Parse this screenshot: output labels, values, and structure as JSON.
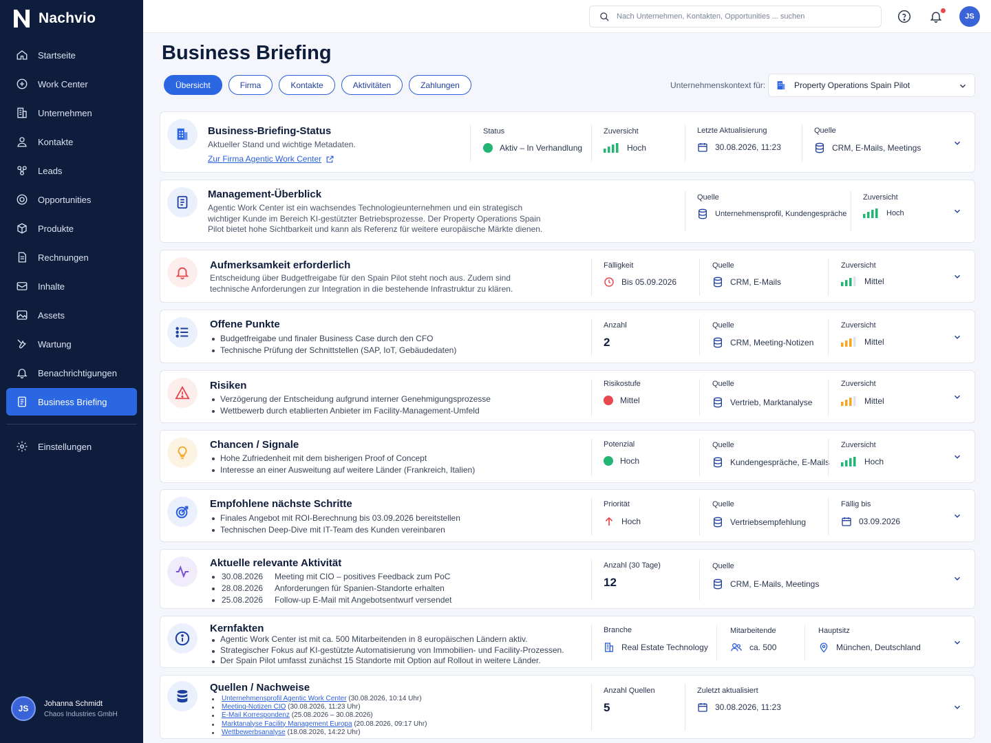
{
  "app": {
    "name": "Nachvio"
  },
  "sidebar": {
    "items": [
      {
        "label": "Startseite",
        "icon": "home-icon"
      },
      {
        "label": "Work Center",
        "icon": "work-center-icon"
      },
      {
        "label": "Unternehmen",
        "icon": "building-icon"
      },
      {
        "label": "Kontakte",
        "icon": "contacts-icon"
      },
      {
        "label": "Leads",
        "icon": "leads-icon"
      },
      {
        "label": "Opportunities",
        "icon": "target-icon"
      },
      {
        "label": "Produkte",
        "icon": "box-icon"
      },
      {
        "label": "Rechnungen",
        "icon": "invoice-icon"
      },
      {
        "label": "Inhalte",
        "icon": "content-icon"
      },
      {
        "label": "Assets",
        "icon": "image-icon"
      },
      {
        "label": "Wartung",
        "icon": "wrench-icon"
      },
      {
        "label": "Benachrichtigungen",
        "icon": "bell-icon"
      },
      {
        "label": "Business Briefing",
        "icon": "briefing-icon",
        "active": true
      }
    ],
    "settings": "Einstellungen",
    "user": {
      "initials": "JS",
      "name": "Johanna Schmidt",
      "company": "Chaos Industries GmbH"
    }
  },
  "topbar": {
    "search_placeholder": "Nach Unternehmen, Kontakten, Opportunities ... suchen",
    "avatar_initials": "JS"
  },
  "page": {
    "title": "Business Briefing",
    "tabs": [
      "Übersicht",
      "Firma",
      "Kontakte",
      "Aktivitäten",
      "Zahlungen"
    ],
    "context_label": "Unternehmenskontext für:",
    "context_value": "Property Operations Spain Pilot"
  },
  "colors": {
    "primary": "#2b66e3",
    "navy": "#0f1d3d",
    "green": "#22b573",
    "red": "#e5484d",
    "orange": "#f5a524"
  },
  "cards": {
    "status": {
      "title": "Business-Briefing-Status",
      "subtitle": "Aktueller Stand und wichtige Metadaten.",
      "link": "Zur Firma Agentic Work Center",
      "m1_label": "Status",
      "m1_value": "Aktiv – In Verhandlung",
      "m2_label": "Zuversicht",
      "m2_value": "Hoch",
      "m3_label": "Letzte Aktualisierung",
      "m3_value": "30.08.2026, 11:23",
      "m4_label": "Quelle",
      "m4_value": "CRM, E-Mails, Meetings"
    },
    "management": {
      "title": "Management-Überblick",
      "lines": [
        "Agentic Work Center ist ein wachsendes Technologieunternehmen und ein strategisch",
        "wichtiger Kunde im Bereich KI-gestützter Betriebsprozesse. Der Property Operations Spain",
        "Pilot bietet hohe Sichtbarkeit und kann als Referenz für weitere europäische Märkte dienen."
      ],
      "m1_label": "Quelle",
      "m1_value": "Unternehmensprofil, Kundengespräche",
      "m2_label": "Zuversicht",
      "m2_value": "Hoch"
    },
    "attention": {
      "title": "Aufmerksamkeit erforderlich",
      "lines": [
        "Entscheidung über Budgetfreigabe für den Spain Pilot steht noch aus. Zudem sind",
        "technische Anforderungen zur Integration in die bestehende Infrastruktur zu klären."
      ],
      "m1_label": "Fälligkeit",
      "m1_value": "Bis 05.09.2026",
      "m2_label": "Quelle",
      "m2_value": "CRM, E-Mails",
      "m3_label": "Zuversicht",
      "m3_value": "Mittel"
    },
    "open": {
      "title": "Offene Punkte",
      "items": [
        "Budgetfreigabe und finaler Business Case durch den CFO",
        "Technische Prüfung der Schnittstellen (SAP, IoT, Gebäudedaten)"
      ],
      "m1_label": "Anzahl",
      "m1_value": "2",
      "m2_label": "Quelle",
      "m2_value": "CRM, Meeting-Notizen",
      "m3_label": "Zuversicht",
      "m3_value": "Mittel"
    },
    "risks": {
      "title": "Risiken",
      "items": [
        "Verzögerung der Entscheidung aufgrund interner Genehmigungsprozesse",
        "Wettbewerb durch etablierten Anbieter im Facility-Management-Umfeld"
      ],
      "m1_label": "Risikostufe",
      "m1_value": "Mittel",
      "m2_label": "Quelle",
      "m2_value": "Vertrieb, Marktanalyse",
      "m3_label": "Zuversicht",
      "m3_value": "Mittel"
    },
    "chances": {
      "title": "Chancen / Signale",
      "items": [
        "Hohe Zufriedenheit mit dem bisherigen Proof of Concept",
        "Interesse an einer Ausweitung auf weitere Länder (Frankreich, Italien)"
      ],
      "m1_label": "Potenzial",
      "m1_value": "Hoch",
      "m2_label": "Quelle",
      "m2_value": "Kundengespräche, E-Mails",
      "m3_label": "Zuversicht",
      "m3_value": "Hoch"
    },
    "next": {
      "title": "Empfohlene nächste Schritte",
      "items": [
        "Finales Angebot mit ROI-Berechnung bis 03.09.2026 bereitstellen",
        "Technischen Deep-Dive mit IT-Team des Kunden vereinbaren"
      ],
      "m1_label": "Priorität",
      "m1_value": "Hoch",
      "m2_label": "Quelle",
      "m2_value": "Vertriebsempfehlung",
      "m3_label": "Fällig bis",
      "m3_value": "03.09.2026"
    },
    "activity": {
      "title": "Aktuelle relevante Aktivität",
      "items": [
        {
          "date": "30.08.2026",
          "text": "Meeting mit CIO – positives Feedback zum PoC"
        },
        {
          "date": "28.08.2026",
          "text": "Anforderungen für Spanien-Standorte erhalten"
        },
        {
          "date": "25.08.2026",
          "text": "Follow-up E-Mail mit Angebotsentwurf versendet"
        }
      ],
      "m1_label": "Anzahl (30 Tage)",
      "m1_value": "12",
      "m2_label": "Quelle",
      "m2_value": "CRM, E-Mails, Meetings"
    },
    "facts": {
      "title": "Kernfakten",
      "items": [
        "Agentic Work Center ist mit ca. 500 Mitarbeitenden in 8 europäischen Ländern aktiv.",
        "Strategischer Fokus auf KI-gestützte Automatisierung von Immobilien- und Facility-Prozessen.",
        "Der Spain Pilot umfasst zunächst 15 Standorte mit Option auf Rollout in weitere Länder."
      ],
      "m1_label": "Branche",
      "m1_value": "Real Estate Technology",
      "m2_label": "Mitarbeitende",
      "m2_value": "ca. 500",
      "m3_label": "Hauptsitz",
      "m3_value": "München, Deutschland"
    },
    "sources": {
      "title": "Quellen / Nachweise",
      "items": [
        {
          "link": "Unternehmensprofil Agentic Work Center",
          "meta": "(30.08.2026, 10:14 Uhr)"
        },
        {
          "link": "Meeting-Notizen CIO",
          "meta": "(30.08.2026, 11:23 Uhr)"
        },
        {
          "link": "E-Mail Korrespondenz",
          "meta": "(25.08.2026 – 30.08.2026)"
        },
        {
          "link": "Marktanalyse Facility Management Europa",
          "meta": "(20.08.2026, 09:17 Uhr)"
        },
        {
          "link": "Wettbewerbsanalyse",
          "meta": "(18.08.2026, 14:22 Uhr)"
        }
      ],
      "m1_label": "Anzahl Quellen",
      "m1_value": "5",
      "m2_label": "Zuletzt aktualisiert",
      "m2_value": "30.08.2026, 11:23"
    }
  }
}
